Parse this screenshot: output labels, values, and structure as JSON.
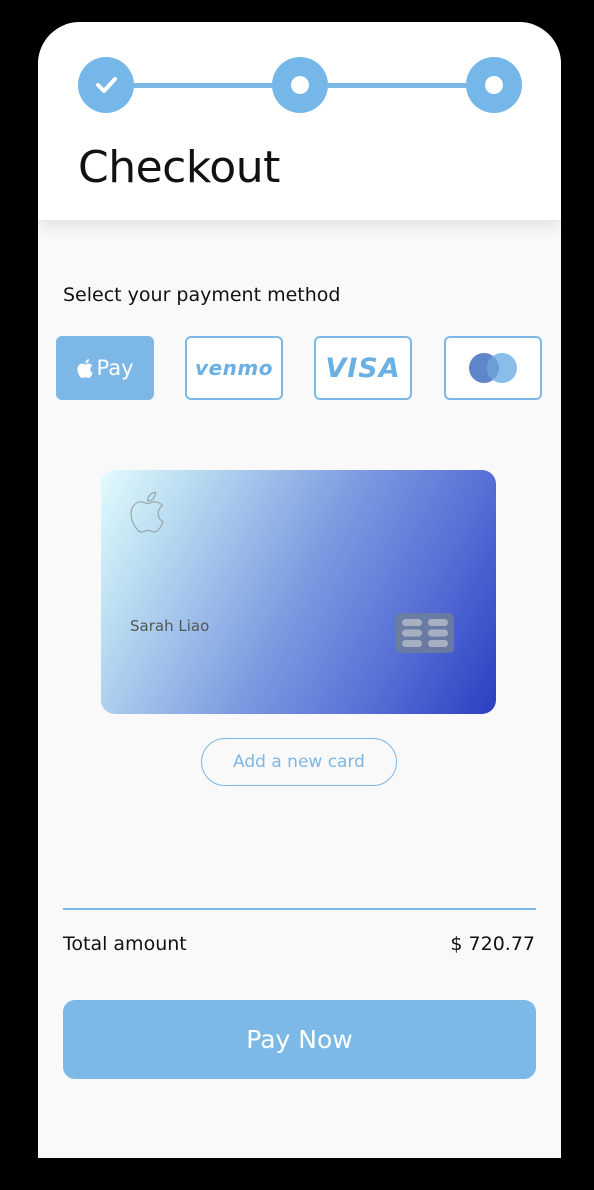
{
  "header": {
    "title": "Checkout",
    "steps": [
      {
        "state": "completed",
        "icon": "check-icon"
      },
      {
        "state": "current",
        "icon": "dot-icon"
      },
      {
        "state": "upcoming",
        "icon": "dot-icon"
      }
    ]
  },
  "payment": {
    "label": "Select your payment method",
    "methods": [
      {
        "name": "Apple Pay",
        "label": "Pay",
        "icon": "apple-icon",
        "selected": true
      },
      {
        "name": "Venmo",
        "label": "venmo",
        "selected": false
      },
      {
        "name": "Visa",
        "label": "VISA",
        "selected": false
      },
      {
        "name": "Mastercard",
        "icon": "mastercard-icon",
        "selected": false
      }
    ]
  },
  "card": {
    "holder": "Sarah Liao",
    "icons": [
      "apple-icon",
      "chip-icon"
    ]
  },
  "add_card_label": "Add a new card",
  "summary": {
    "total_label": "Total amount",
    "total_value": "$ 720.77"
  },
  "pay_button_label": "Pay Now",
  "colors": {
    "accent": "#7db7e6",
    "background": "#f9f9f9",
    "card_gradient_start": "#e2fbfd",
    "card_gradient_end": "#2a3fc0"
  }
}
